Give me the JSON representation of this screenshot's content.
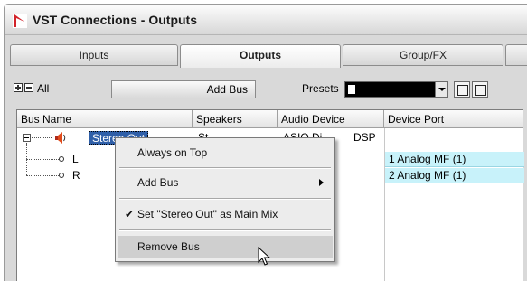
{
  "window": {
    "title": "VST Connections - Outputs"
  },
  "tabs": [
    {
      "label": "Inputs",
      "active": false
    },
    {
      "label": "Outputs",
      "active": true
    },
    {
      "label": "Group/FX",
      "active": false
    }
  ],
  "toolbar": {
    "all_label": "All",
    "add_bus_label": "Add Bus",
    "presets_label": "Presets",
    "preset_value": ""
  },
  "table": {
    "columns": [
      "Bus Name",
      "Speakers",
      "Audio Device",
      "Device Port"
    ],
    "rows": [
      {
        "bus_name": "Stereo Out",
        "speakers": "St...",
        "audio_device": "ASIO DirectX Full Duplex Driver / DSP",
        "device_port": ""
      },
      {
        "bus_name": "L",
        "speakers": "",
        "audio_device": "",
        "device_port": "1 Analog MF (1)"
      },
      {
        "bus_name": "R",
        "speakers": "",
        "audio_device": "",
        "device_port": "2 Analog MF (1)"
      }
    ],
    "visible_text": {
      "bus_name_sel": "Stereo Out",
      "audio_device_partial": "ASIO Di",
      "audio_device_tail": "DSP",
      "speakers_partial": "St"
    }
  },
  "context_menu": {
    "items": [
      {
        "label": "Always on Top",
        "checked": false,
        "submenu": false,
        "hovered": false
      },
      {
        "label": "Add Bus",
        "checked": false,
        "submenu": true,
        "hovered": false
      },
      {
        "label": "Set \"Stereo Out\" as Main Mix",
        "checked": true,
        "submenu": false,
        "hovered": false
      },
      {
        "label": "Remove Bus",
        "checked": false,
        "submenu": false,
        "hovered": true
      }
    ]
  },
  "colors": {
    "accent_logo": "#d2232a",
    "selection": "#2f5fa8",
    "port_cell": "#c8f2fa",
    "menu_hover": "#cfcfcf"
  },
  "icons": {
    "app": "vst-connections-logo-icon",
    "expand_all": "expand-all-icon",
    "collapse_all": "collapse-all-icon",
    "speaker": "speaker-icon",
    "jack": "audio-jack-icon",
    "cursor": "mouse-pointer-icon"
  }
}
